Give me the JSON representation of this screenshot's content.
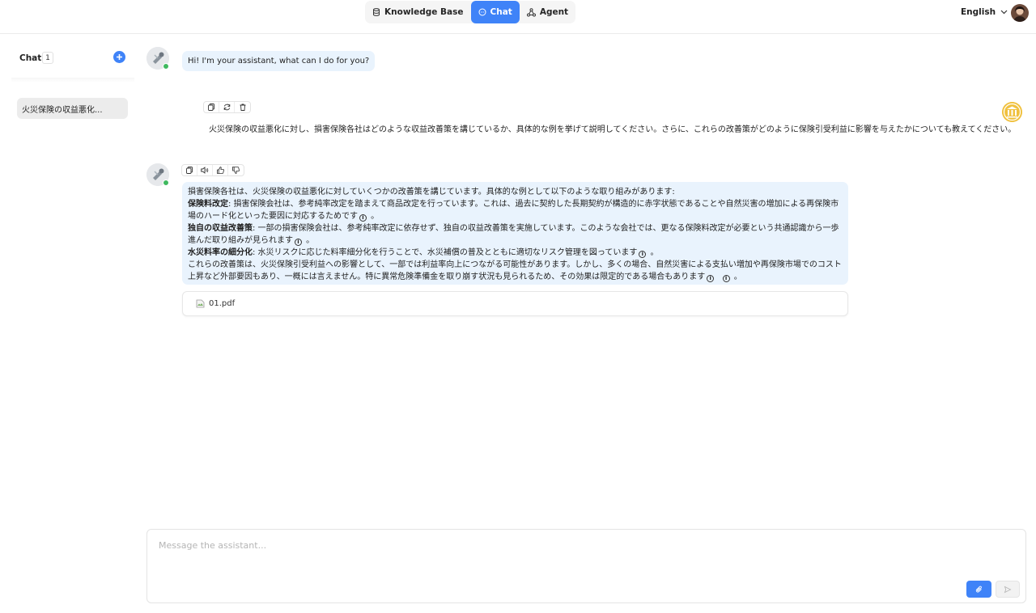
{
  "nav": {
    "tabs": [
      {
        "label": "Knowledge Base",
        "icon": "database-icon",
        "active": false
      },
      {
        "label": "Chat",
        "icon": "chat-bubble-icon",
        "active": true
      },
      {
        "label": "Agent",
        "icon": "agent-graph-icon",
        "active": false
      }
    ]
  },
  "header": {
    "language": "English"
  },
  "sidebar": {
    "title": "Chat",
    "count": "1",
    "items": [
      {
        "label": "火災保険の収益悪化..."
      }
    ]
  },
  "conversation": {
    "greeting": "Hi! I'm your assistant, what can I do for you?",
    "user_message": "火災保険の収益悪化に対し、損害保険各社はどのような収益改善策を講じているか、具体的な例を挙げて説明してください。さらに、これらの改善策がどのように保険引受利益に影響を与えたかについても教えてください。",
    "answer": {
      "intro": "損害保険各社は、火災保険の収益悪化に対していくつかの改善策を講じています。具体的な例として以下のような取り組みがあります:",
      "points": [
        {
          "heading": "保険料改定",
          "text": ": 損害保険会社は、参考純率改定を踏まえて商品改定を行っています。これは、過去に契約した長期契約が構造的に赤字状態であることや自然災害の増加による再保険市場のハード化といった要因に対応するためです",
          "tail": " 。"
        },
        {
          "heading": "独自の収益改善策",
          "text": ": 一部の損害保険会社は、参考純率改定に依存せず、独自の収益改善策を実施しています。このような会社では、更なる保険料改定が必要という共通認識から一歩進んだ取り組みが見られます",
          "tail": " 。"
        },
        {
          "heading": "水災料率の細分化",
          "text": ": 水災リスクに応じた料率細分化を行うことで、水災補償の普及とともに適切なリスク管理を図っています",
          "tail": " 。"
        }
      ],
      "conclusion": "これらの改善策は、火災保険引受利益への影響として、一部では利益率向上につながる可能性があります。しかし、多くの場合、自然災害による支払い増加や再保険市場でのコスト上昇など外部要因もあり、一概には言えません。特に異常危険準備金を取り崩す状況も見られるため、その効果は限定的である場合もあります",
      "conclusion_tail": " 。"
    },
    "attachment": {
      "name": "01.pdf"
    }
  },
  "composer": {
    "placeholder": "Message the assistant..."
  },
  "colors": {
    "accent": "#3f83f8",
    "bubble": "#e9f3fd",
    "online": "#3fb95f"
  }
}
